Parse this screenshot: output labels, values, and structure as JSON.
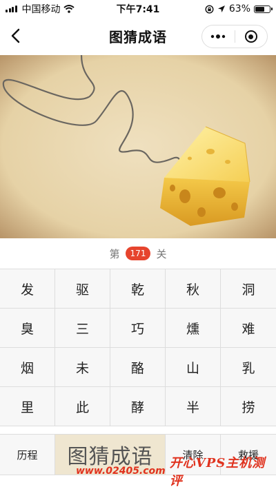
{
  "status_bar": {
    "carrier": "中国移动",
    "time": "下午7:41",
    "battery": "63%",
    "battery_level": 0.63,
    "icons": [
      "signal-icon",
      "wifi-icon",
      "lock-rotation-icon",
      "location-icon",
      "battery-icon"
    ]
  },
  "nav": {
    "title": "图猜成语",
    "icons": [
      "back-arrow-icon",
      "more-dots-icon",
      "close-target-icon"
    ]
  },
  "level": {
    "prefix": "第",
    "number": "171",
    "suffix": "关"
  },
  "grid": {
    "rows": [
      [
        "发",
        "驱",
        "乾",
        "秋",
        "洞"
      ],
      [
        "臭",
        "三",
        "巧",
        "燻",
        "难"
      ],
      [
        "烟",
        "未",
        "酪",
        "山",
        "乳"
      ],
      [
        "里",
        "此",
        "酵",
        "半",
        "捞"
      ]
    ]
  },
  "bottom": {
    "history_label": "历程",
    "answer_display": "图猜成语",
    "clear_label": "清除",
    "help_label": "救援"
  },
  "watermark": {
    "url": "www.02405.com",
    "tag": "开心VPS主机测评"
  },
  "colors": {
    "accent": "#e6442d",
    "cell_bg": "#f7f7f7",
    "answer_bg": "#efe6d0",
    "cheese": "#f1c84a"
  }
}
